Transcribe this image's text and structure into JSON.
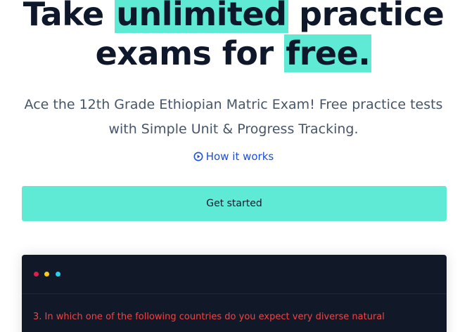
{
  "hero": {
    "title_part1": "Take ",
    "title_highlight1": "unlimited",
    "title_part2": " practice",
    "title_part3": "exams for ",
    "title_highlight2": "free.",
    "subtitle_line1": "Ace the 12th Grade Ethiopian Matric Exam! Free practice tests",
    "subtitle_line2": "with Simple Unit & Progress Tracking.",
    "how_it_works": "How it works",
    "how_it_works_icon": "play-circle-icon",
    "cta_label": "Get started"
  },
  "demo": {
    "window_dots": [
      "red",
      "yellow",
      "cyan"
    ],
    "question": "3. In which one of the following countries do you expect very diverse natural"
  },
  "colors": {
    "accent": "#5eead4",
    "heading": "#0f172a",
    "body": "#475569",
    "link": "#1d4ed8",
    "demo_bg": "#111827",
    "question": "#ef4444"
  }
}
